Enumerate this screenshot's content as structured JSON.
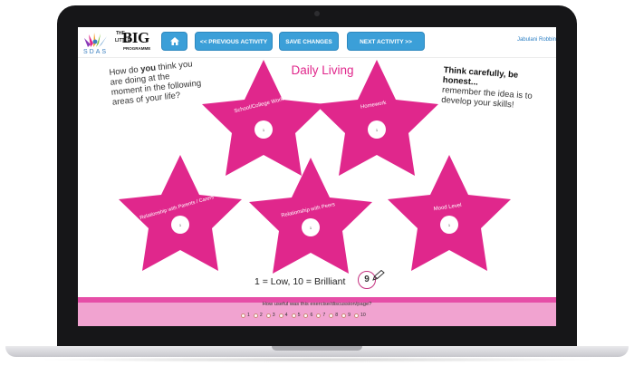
{
  "toolbar": {
    "home_icon": "home-icon",
    "prev_label": "<< PREVIOUS ACTIVITY",
    "save_label": "SAVE CHANGES",
    "next_label": "NEXT ACTIVITY >>",
    "user_name": "Jabulani Robbin"
  },
  "logo": {
    "sdas": "SDAS",
    "the": "THE",
    "little": "LITTLE",
    "big": "BIG",
    "programme": "PROGRAMME"
  },
  "page": {
    "title": "Daily Living",
    "question_part1": "How do ",
    "question_you": "you",
    "question_part2": " think you are doing at the moment in the following areas of your life?",
    "note_strong": "Think carefully, be honest...",
    "note_rest": "remember the idea is to develop your skills!",
    "scale_text": "1 = Low, 10 = Brilliant",
    "scale_value": "9"
  },
  "stars": [
    {
      "label": "School/College Work",
      "value": "1"
    },
    {
      "label": "Homework",
      "value": "1"
    },
    {
      "label": "Relationship with Parents / Carers",
      "value": "1"
    },
    {
      "label": "Relationship with Peers",
      "value": "1"
    },
    {
      "label": "Mood Level",
      "value": "1"
    }
  ],
  "rating": {
    "question": "How useful was this exercise/discussion/page?",
    "options": [
      "1",
      "2",
      "3",
      "4",
      "5",
      "6",
      "7",
      "8",
      "9",
      "10"
    ]
  },
  "colors": {
    "star": "#e0278c",
    "button": "#3b9fd8",
    "band": "#ee7fbf"
  }
}
